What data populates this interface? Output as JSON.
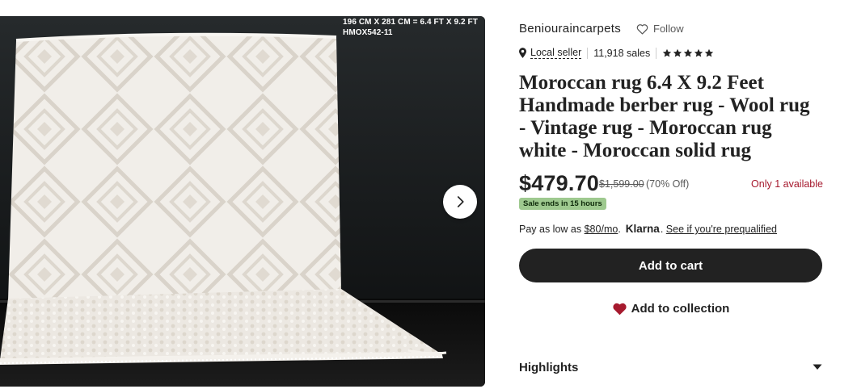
{
  "image": {
    "overlay_line1": "196 CM X 281 CM = 6.4 FT X 9.2 FT",
    "overlay_line2": "HMOX542-11",
    "next_icon": "chevron-right-icon"
  },
  "shop": {
    "name": "Beniouraincarpets",
    "follow_label": "Follow",
    "follow_icon": "heart-outline-icon"
  },
  "meta": {
    "pin_icon": "location-pin-icon",
    "local_seller": "Local seller",
    "sales": "11,918 sales",
    "rating_stars": 5
  },
  "listing": {
    "title": "Moroccan rug 6.4 X 9.2 Feet Handmade berber rug - Wool rug - Vintage rug - Moroccan rug white - Moroccan solid rug"
  },
  "price": {
    "current": "$479.70",
    "original": "$1,599.00",
    "discount": "(70% Off)",
    "availability": "Only 1 available"
  },
  "sale": {
    "badge": "Sale ends in 15 hours"
  },
  "klarna": {
    "prefix": "Pay as low as",
    "amount": "$80/mo",
    "brand": "Klarna",
    "cta": "See if you're prequalified"
  },
  "actions": {
    "add_to_cart": "Add to cart",
    "add_to_collection": "Add to collection"
  },
  "accordion": {
    "highlights": "Highlights"
  },
  "colors": {
    "availability": "#a61a2e",
    "sale_badge": "#9ec98f",
    "primary_button": "#222222"
  }
}
